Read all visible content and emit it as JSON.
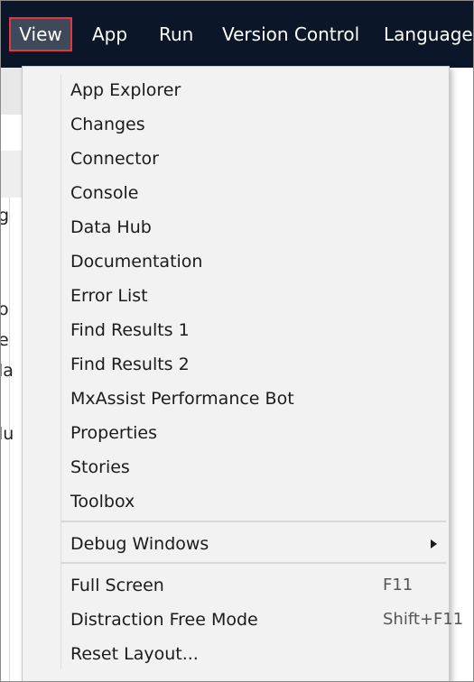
{
  "menubar": {
    "items": [
      {
        "label": "View"
      },
      {
        "label": "App"
      },
      {
        "label": "Run"
      },
      {
        "label": "Version Control"
      },
      {
        "label": "Language"
      }
    ]
  },
  "view_menu": {
    "panels": [
      {
        "label": "App Explorer"
      },
      {
        "label": "Changes"
      },
      {
        "label": "Connector"
      },
      {
        "label": "Console"
      },
      {
        "label": "Data Hub"
      },
      {
        "label": "Documentation"
      },
      {
        "label": "Error List"
      },
      {
        "label": "Find Results 1"
      },
      {
        "label": "Find Results 2"
      },
      {
        "label": "MxAssist Performance Bot"
      },
      {
        "label": "Properties"
      },
      {
        "label": "Stories"
      },
      {
        "label": "Toolbox"
      }
    ],
    "debug_windows": {
      "label": "Debug Windows"
    },
    "full_screen": {
      "label": "Full Screen",
      "shortcut": "F11"
    },
    "distraction_free": {
      "label": "Distraction Free Mode",
      "shortcut": "Shift+F11"
    },
    "reset_layout": {
      "label": "Reset Layout..."
    }
  },
  "background_glyphs": [
    "g",
    "o",
    "e",
    "la",
    "lu"
  ],
  "colors": {
    "menubar_bg": "#0b1628",
    "active_highlight": "#e0383f",
    "menu_bg": "#f2f2f2"
  }
}
